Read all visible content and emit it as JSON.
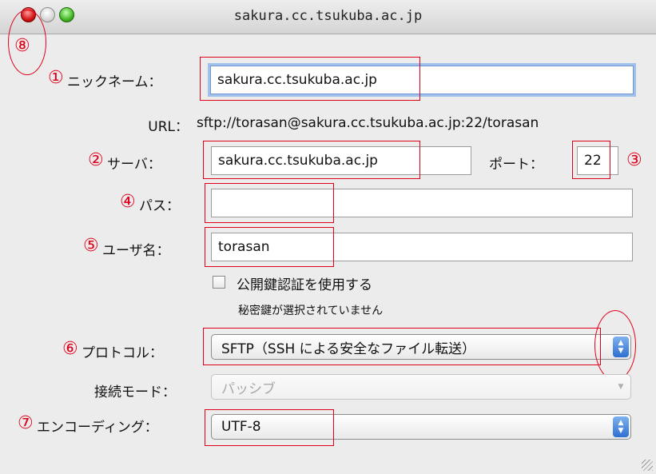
{
  "window": {
    "title": "sakura.cc.tsukuba.ac.jp"
  },
  "annotations": {
    "n1": "①",
    "n2": "②",
    "n3": "③",
    "n4": "④",
    "n5": "⑤",
    "n6": "⑥",
    "n7": "⑦",
    "n8": "⑧"
  },
  "form": {
    "nickname": {
      "label": "ニックネーム：",
      "value": "sakura.cc.tsukuba.ac.jp"
    },
    "url": {
      "label": "URL：",
      "value": "sftp://torasan@sakura.cc.tsukuba.ac.jp:22/torasan"
    },
    "server": {
      "label": "サーバ：",
      "value": "sakura.cc.tsukuba.ac.jp"
    },
    "port": {
      "label": "ポート：",
      "value": "22"
    },
    "path": {
      "label": "パス：",
      "value": ""
    },
    "username": {
      "label": "ユーザ名：",
      "value": "torasan"
    },
    "pubkey": {
      "label": "公開鍵認証を使用する",
      "checked": false,
      "note": "秘密鍵が選択されていません"
    },
    "protocol": {
      "label": "プロトコル：",
      "value": "SFTP（SSH による安全なファイル転送）"
    },
    "connect_mode": {
      "label": "接続モード：",
      "value": "パッシブ"
    },
    "encoding": {
      "label": "エンコーディング：",
      "value": "UTF-8"
    }
  },
  "colors": {
    "annotation": "#e0001a",
    "focus_ring": "#9fc1eb",
    "select_stepper": "#2e6fd0"
  }
}
